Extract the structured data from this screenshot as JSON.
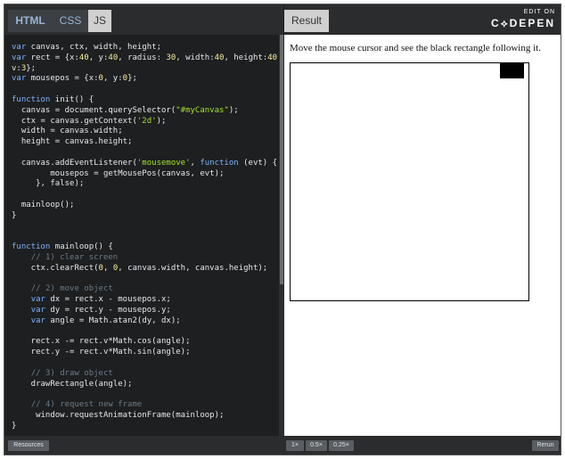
{
  "editor": {
    "tabs": [
      {
        "label": "HTML"
      },
      {
        "label": "CSS"
      },
      {
        "label": "JS"
      }
    ],
    "code_lines": [
      "var canvas, ctx, width, height;",
      "var rect = {x:40, y:40, radius: 30, width:40, height:40,",
      "v:3};",
      "var mousepos = {x:0, y:0};",
      "",
      "function init() {",
      "  canvas = document.querySelector(\"#myCanvas\");",
      "  ctx = canvas.getContext('2d');",
      "  width = canvas.width;",
      "  height = canvas.height;",
      "",
      "  canvas.addEventListener('mousemove', function (evt) {",
      "        mousepos = getMousePos(canvas, evt);",
      "     }, false);",
      "",
      "  mainloop();",
      "}",
      "",
      "",
      "function mainloop() {",
      "    // 1) clear screen",
      "    ctx.clearRect(0, 0, canvas.width, canvas.height);",
      "",
      "    // 2) move object",
      "    var dx = rect.x - mousepos.x;",
      "    var dy = rect.y - mousepos.y;",
      "    var angle = Math.atan2(dy, dx);",
      "",
      "    rect.x -= rect.v*Math.cos(angle);",
      "    rect.y -= rect.v*Math.sin(angle);",
      "",
      "    // 3) draw object",
      "    drawRectangle(angle);",
      "",
      "    // 4) request new frame",
      "     window.requestAnimationFrame(mainloop);",
      "}"
    ]
  },
  "result": {
    "tab_label": "Result",
    "edit_on": "EDIT ON",
    "brand": "C⟡DEPEN",
    "instruction": "Move the mouse cursor and see the black rectangle following it."
  },
  "footer": {
    "resources": "Resources",
    "zoom_1x": "1×",
    "zoom_05x": "0.5×",
    "zoom_025x": "0.25×",
    "rerun": "Rerun"
  },
  "colors": {
    "editor_bg": "#1d1f20",
    "keyword": "#7fb3ff",
    "number": "#f9ee98",
    "string": "#a6e22e",
    "comment": "#6c7a89"
  }
}
